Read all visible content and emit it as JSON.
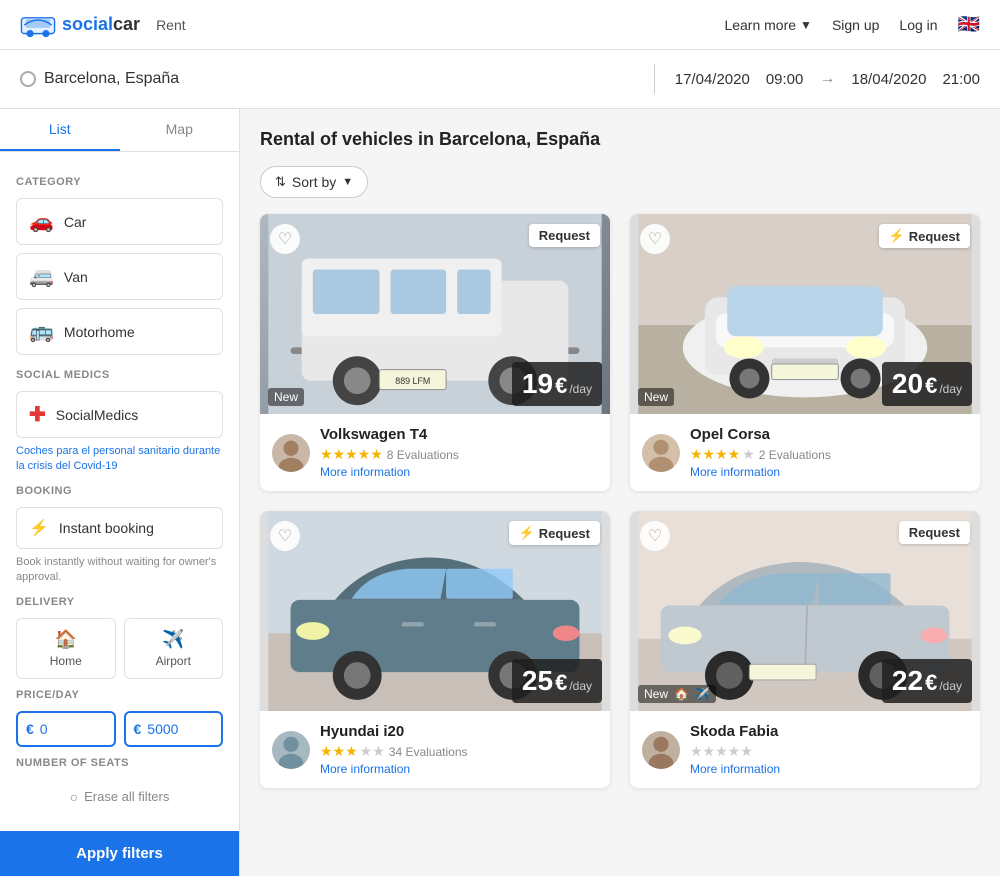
{
  "header": {
    "logo_text": "socialcar",
    "nav_rent": "Rent",
    "learn_more": "Learn more",
    "sign_up": "Sign up",
    "log_in": "Log in",
    "flag": "🇬🇧"
  },
  "search": {
    "location": "Barcelona, España",
    "date_from": "17/04/2020",
    "time_from": "09:00",
    "date_to": "18/04/2020",
    "time_to": "21:00",
    "arrow": "→"
  },
  "sidebar": {
    "tab_list": "List",
    "tab_map": "Map",
    "category_title": "CATEGORY",
    "categories": [
      {
        "icon": "🚗",
        "label": "Car"
      },
      {
        "icon": "🚐",
        "label": "Van"
      },
      {
        "icon": "🚌",
        "label": "Motorhome"
      }
    ],
    "social_medics_title": "SOCIAL MEDICS",
    "social_medics_label": "SocialMedics",
    "covid_text": "Coches para el personal sanitario durante la crisis del Covid-19",
    "booking_title": "BOOKING",
    "instant_booking_label": "Instant booking",
    "booking_desc": "Book instantly without waiting for owner's approval.",
    "delivery_title": "DELIVERY",
    "delivery_home": "Home",
    "delivery_airport": "Airport",
    "price_title": "PRICE/DAY",
    "price_min": "0",
    "price_max": "5000",
    "seats_title": "NUMBER OF SEATS",
    "erase_filters": "Erase all filters",
    "apply_filters": "Apply filters"
  },
  "content": {
    "page_title": "Rental of vehicles in Barcelona, España",
    "sort_by": "Sort by",
    "cars": [
      {
        "id": 1,
        "name": "Volkswagen T4",
        "price": "19",
        "period": "/day",
        "stars": 5,
        "evaluations": "8 Evaluations",
        "more_info": "More information",
        "new_label": "New",
        "request_label": "Request",
        "is_instant": false,
        "avatar_icon": "👤"
      },
      {
        "id": 2,
        "name": "Opel Corsa",
        "price": "20",
        "period": "/day",
        "stars": 4,
        "evaluations": "2 Evaluations",
        "more_info": "More information",
        "new_label": "New",
        "request_label": "Request",
        "is_instant": true,
        "avatar_icon": "👤"
      },
      {
        "id": 3,
        "name": "Hyundai i20",
        "price": "25",
        "period": "/day",
        "stars": 3,
        "evaluations": "34 Evaluations",
        "more_info": "More information",
        "new_label": "",
        "request_label": "Request",
        "is_instant": true,
        "avatar_icon": "👤"
      },
      {
        "id": 4,
        "name": "Skoda Fabia",
        "price": "22",
        "period": "/day",
        "stars": 0,
        "evaluations": "",
        "more_info": "More information",
        "new_label": "New",
        "request_label": "Request",
        "is_instant": false,
        "avatar_icon": "👤",
        "has_home": true,
        "has_airport": true
      }
    ]
  }
}
